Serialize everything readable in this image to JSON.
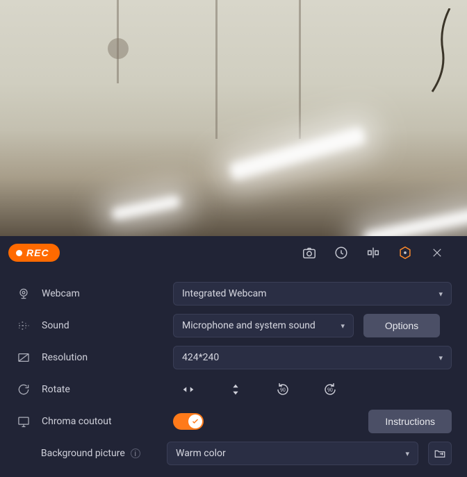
{
  "toolbar": {
    "rec_label": "REC"
  },
  "labels": {
    "webcam": "Webcam",
    "sound": "Sound",
    "resolution": "Resolution",
    "rotate": "Rotate",
    "chroma": "Chroma coutout",
    "background": "Background picture"
  },
  "values": {
    "webcam": "Integrated Webcam",
    "sound": "Microphone and system sound",
    "resolution": "424*240",
    "background": "Warm color"
  },
  "buttons": {
    "options": "Options",
    "instructions": "Instructions"
  },
  "toggles": {
    "chroma": true
  }
}
